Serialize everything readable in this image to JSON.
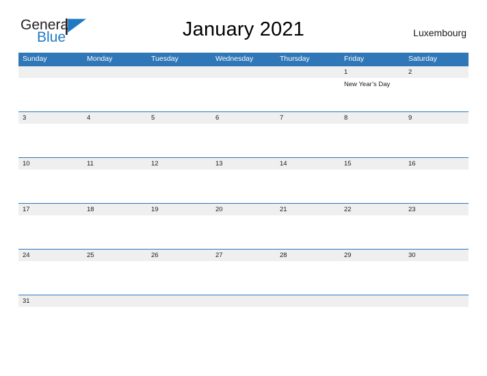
{
  "brand": {
    "word_one": "General",
    "word_two": "Blue",
    "flag_icon": "blue-flag-triangle-icon",
    "dark_color": "#231f20",
    "blue_color": "#1f7ac4"
  },
  "header": {
    "title": "January 2021",
    "location": "Luxembourg"
  },
  "theme": {
    "header_blue": "#3077b8",
    "rule_blue": "#2e75b6",
    "date_band_gray": "#efefef",
    "text_color": "#1a1a1a"
  },
  "calendar": {
    "weekdays": [
      "Sunday",
      "Monday",
      "Tuesday",
      "Wednesday",
      "Thursday",
      "Friday",
      "Saturday"
    ],
    "weeks": [
      {
        "days": [
          {
            "date": "",
            "event": ""
          },
          {
            "date": "",
            "event": ""
          },
          {
            "date": "",
            "event": ""
          },
          {
            "date": "",
            "event": ""
          },
          {
            "date": "",
            "event": ""
          },
          {
            "date": "1",
            "event": "New Year’s Day"
          },
          {
            "date": "2",
            "event": ""
          }
        ]
      },
      {
        "days": [
          {
            "date": "3",
            "event": ""
          },
          {
            "date": "4",
            "event": ""
          },
          {
            "date": "5",
            "event": ""
          },
          {
            "date": "6",
            "event": ""
          },
          {
            "date": "7",
            "event": ""
          },
          {
            "date": "8",
            "event": ""
          },
          {
            "date": "9",
            "event": ""
          }
        ]
      },
      {
        "days": [
          {
            "date": "10",
            "event": ""
          },
          {
            "date": "11",
            "event": ""
          },
          {
            "date": "12",
            "event": ""
          },
          {
            "date": "13",
            "event": ""
          },
          {
            "date": "14",
            "event": ""
          },
          {
            "date": "15",
            "event": ""
          },
          {
            "date": "16",
            "event": ""
          }
        ]
      },
      {
        "days": [
          {
            "date": "17",
            "event": ""
          },
          {
            "date": "18",
            "event": ""
          },
          {
            "date": "19",
            "event": ""
          },
          {
            "date": "20",
            "event": ""
          },
          {
            "date": "21",
            "event": ""
          },
          {
            "date": "22",
            "event": ""
          },
          {
            "date": "23",
            "event": ""
          }
        ]
      },
      {
        "days": [
          {
            "date": "24",
            "event": ""
          },
          {
            "date": "25",
            "event": ""
          },
          {
            "date": "26",
            "event": ""
          },
          {
            "date": "27",
            "event": ""
          },
          {
            "date": "28",
            "event": ""
          },
          {
            "date": "29",
            "event": ""
          },
          {
            "date": "30",
            "event": ""
          }
        ]
      },
      {
        "days": [
          {
            "date": "31",
            "event": ""
          },
          {
            "date": "",
            "event": ""
          },
          {
            "date": "",
            "event": ""
          },
          {
            "date": "",
            "event": ""
          },
          {
            "date": "",
            "event": ""
          },
          {
            "date": "",
            "event": ""
          },
          {
            "date": "",
            "event": ""
          }
        ]
      }
    ]
  }
}
